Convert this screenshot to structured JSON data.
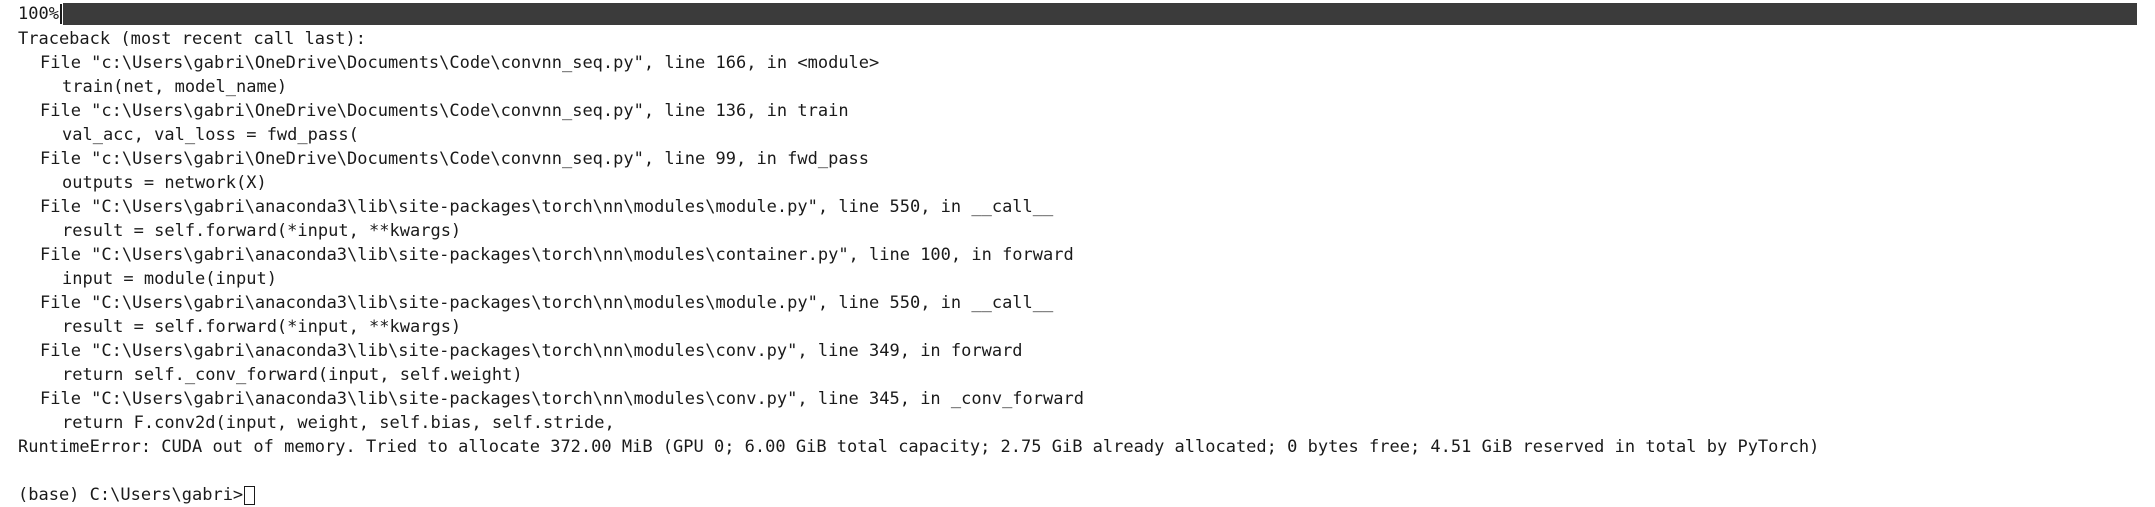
{
  "progress": {
    "percent_label": "100%",
    "fraction": 1.0,
    "bar_color": "#3b3b3b"
  },
  "traceback": {
    "header": "Traceback (most recent call last):",
    "frames": [
      {
        "location": "File \"c:\\Users\\gabri\\OneDrive\\Documents\\Code\\convnn_seq.py\", line 166, in <module>",
        "code": "train(net, model_name)"
      },
      {
        "location": "File \"c:\\Users\\gabri\\OneDrive\\Documents\\Code\\convnn_seq.py\", line 136, in train",
        "code": "val_acc, val_loss = fwd_pass("
      },
      {
        "location": "File \"c:\\Users\\gabri\\OneDrive\\Documents\\Code\\convnn_seq.py\", line 99, in fwd_pass",
        "code": "outputs = network(X)"
      },
      {
        "location": "File \"C:\\Users\\gabri\\anaconda3\\lib\\site-packages\\torch\\nn\\modules\\module.py\", line 550, in __call__",
        "code": "result = self.forward(*input, **kwargs)"
      },
      {
        "location": "File \"C:\\Users\\gabri\\anaconda3\\lib\\site-packages\\torch\\nn\\modules\\container.py\", line 100, in forward",
        "code": "input = module(input)"
      },
      {
        "location": "File \"C:\\Users\\gabri\\anaconda3\\lib\\site-packages\\torch\\nn\\modules\\module.py\", line 550, in __call__",
        "code": "result = self.forward(*input, **kwargs)"
      },
      {
        "location": "File \"C:\\Users\\gabri\\anaconda3\\lib\\site-packages\\torch\\nn\\modules\\conv.py\", line 349, in forward",
        "code": "return self._conv_forward(input, self.weight)"
      },
      {
        "location": "File \"C:\\Users\\gabri\\anaconda3\\lib\\site-packages\\torch\\nn\\modules\\conv.py\", line 345, in _conv_forward",
        "code": "return F.conv2d(input, weight, self.bias, self.stride,"
      }
    ],
    "error": "RuntimeError: CUDA out of memory. Tried to allocate 372.00 MiB (GPU 0; 6.00 GiB total capacity; 2.75 GiB already allocated; 0 bytes free; 4.51 GiB reserved in total by PyTorch)"
  },
  "prompt": {
    "text": "(base) C:\\Users\\gabri>"
  }
}
